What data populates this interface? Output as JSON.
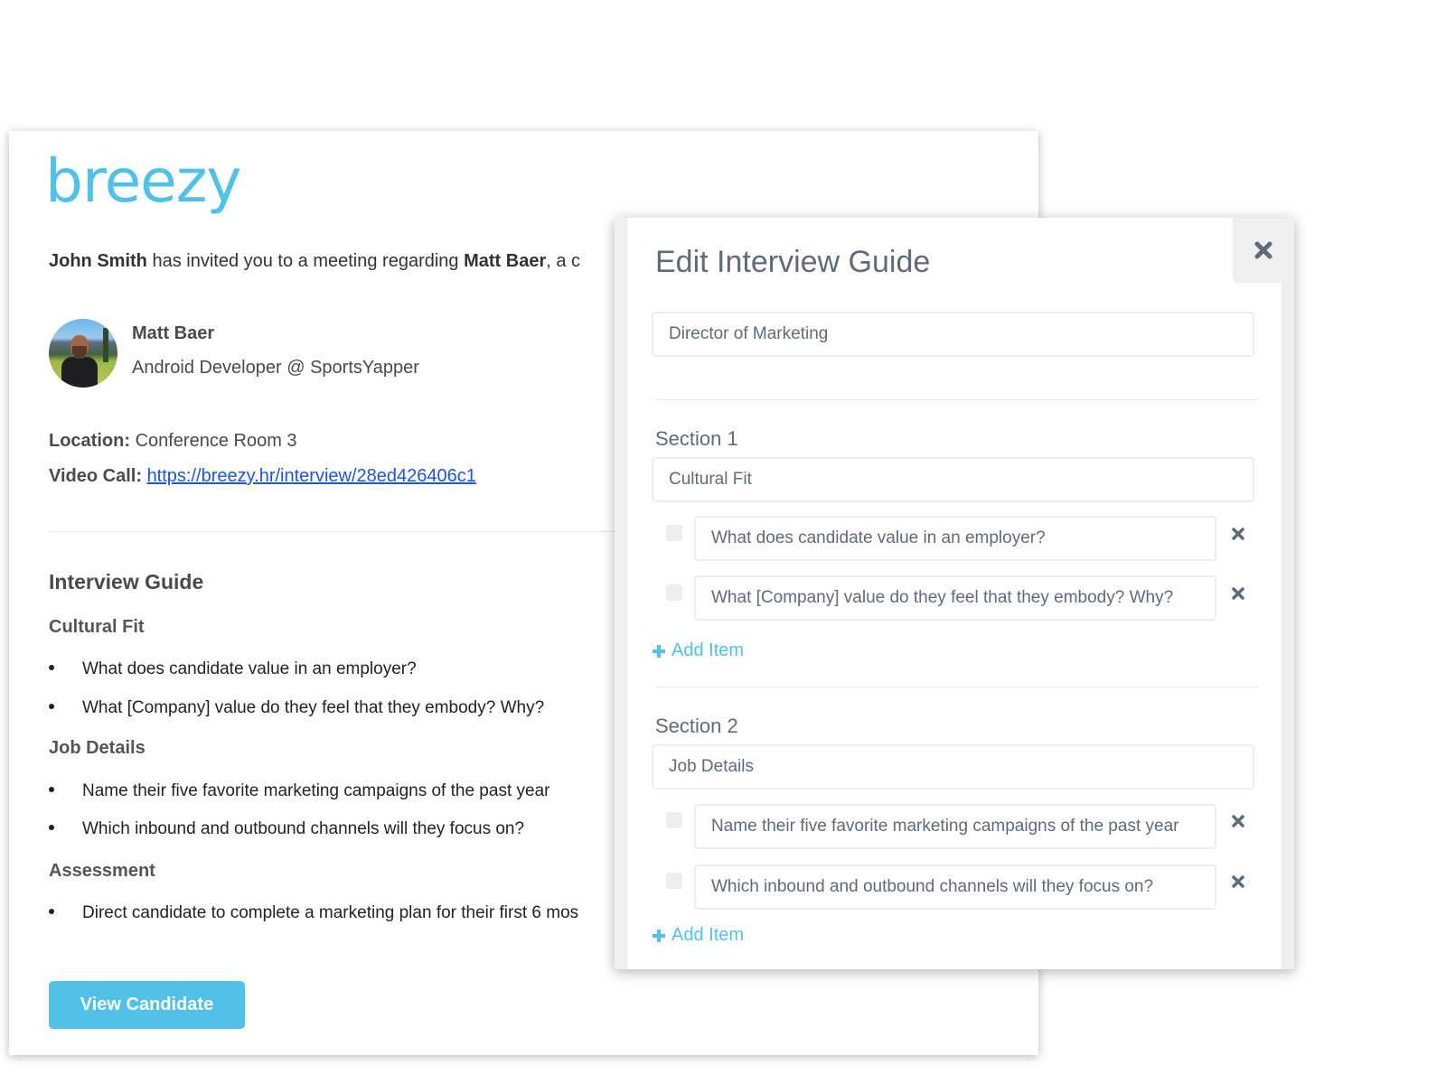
{
  "email": {
    "logo": "breezy",
    "invite": {
      "inviter": "John Smith",
      "text_middle": " has invited you to a meeting regarding ",
      "candidate": "Matt Baer",
      "text_end": ", a c"
    },
    "candidate": {
      "name": "Matt Baer",
      "role": "Android Developer @ SportsYapper"
    },
    "location_label": "Location:",
    "location_value": "Conference Room 3",
    "video_label": "Video Call:",
    "video_link": "https://breezy.hr/interview/28ed426406c1",
    "guide_title": "Interview Guide",
    "sections": [
      {
        "title": "Cultural Fit",
        "items": [
          "What does candidate value in an employer?",
          "What [Company] value do they feel that they embody? Why?"
        ]
      },
      {
        "title": "Job Details",
        "items": [
          "Name their five favorite marketing campaigns of the past year",
          "Which inbound and outbound channels will they focus on?"
        ]
      },
      {
        "title": "Assessment",
        "items": [
          "Direct candidate to complete a marketing plan for their first 6 mos"
        ]
      }
    ],
    "view_button": "View Candidate"
  },
  "modal": {
    "title": "Edit Interview Guide",
    "guide_name": "Director of Marketing",
    "add_item_label": "Add Item",
    "sections": [
      {
        "label": "Section 1",
        "name": "Cultural Fit",
        "items": [
          "What does candidate value in an employer?",
          "What [Company] value do they feel that they embody? Why?"
        ]
      },
      {
        "label": "Section 2",
        "name": "Job Details",
        "items": [
          "Name their five favorite marketing campaigns of the past year",
          "Which inbound and outbound channels will they focus on?"
        ]
      }
    ]
  },
  "colors": {
    "brand": "#52c1ea",
    "modal_text": "#5f6b78",
    "link": "#1a56d6"
  }
}
